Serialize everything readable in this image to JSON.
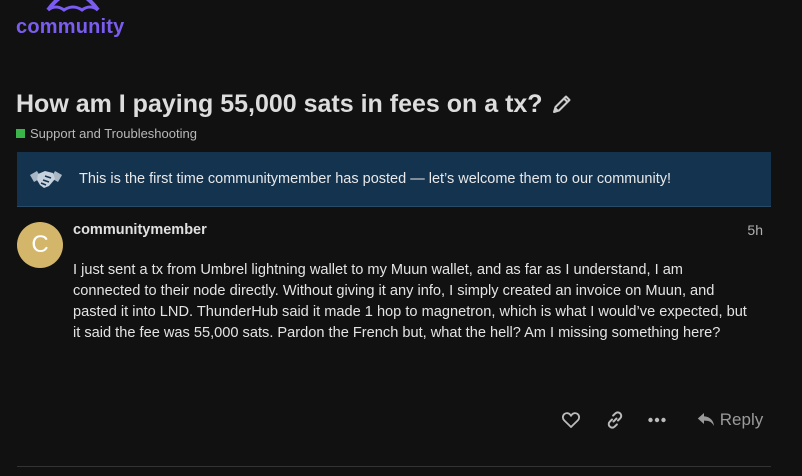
{
  "header": {
    "logo_text": "community",
    "logo_icon": "umbrella-icon",
    "brand_color": "#7b5cf0"
  },
  "topic": {
    "title": "How am I paying 55,000 sats in fees on a tx?",
    "edit_icon": "pencil-icon",
    "category": "Support and Troubleshooting",
    "category_color": "#3ab54a"
  },
  "welcome_banner": {
    "icon": "handshake-icon",
    "text": "This is the first time communitymember has posted — let’s welcome them to our community!",
    "background": "#14334f"
  },
  "post": {
    "avatar_letter": "C",
    "avatar_color": "#d3b66a",
    "username": "communitymember",
    "time": "5h",
    "body": "I just sent a tx from Umbrel lightning wallet to my Muun wallet, and as far as I understand, I am connected to their node directly. Without giving it any info, I simply created an invoice on Muun, and pasted it into LND. ThunderHub said it made 1 hop to magnetron, which is what I would’ve expected, but it said the fee was 55,000 sats. Pardon the French but, what the hell? Am I missing something here?"
  },
  "actions": {
    "like_icon": "heart-icon",
    "link_icon": "link-icon",
    "more_icon": "ellipsis-icon",
    "reply_icon": "reply-icon",
    "reply_label": "Reply"
  }
}
